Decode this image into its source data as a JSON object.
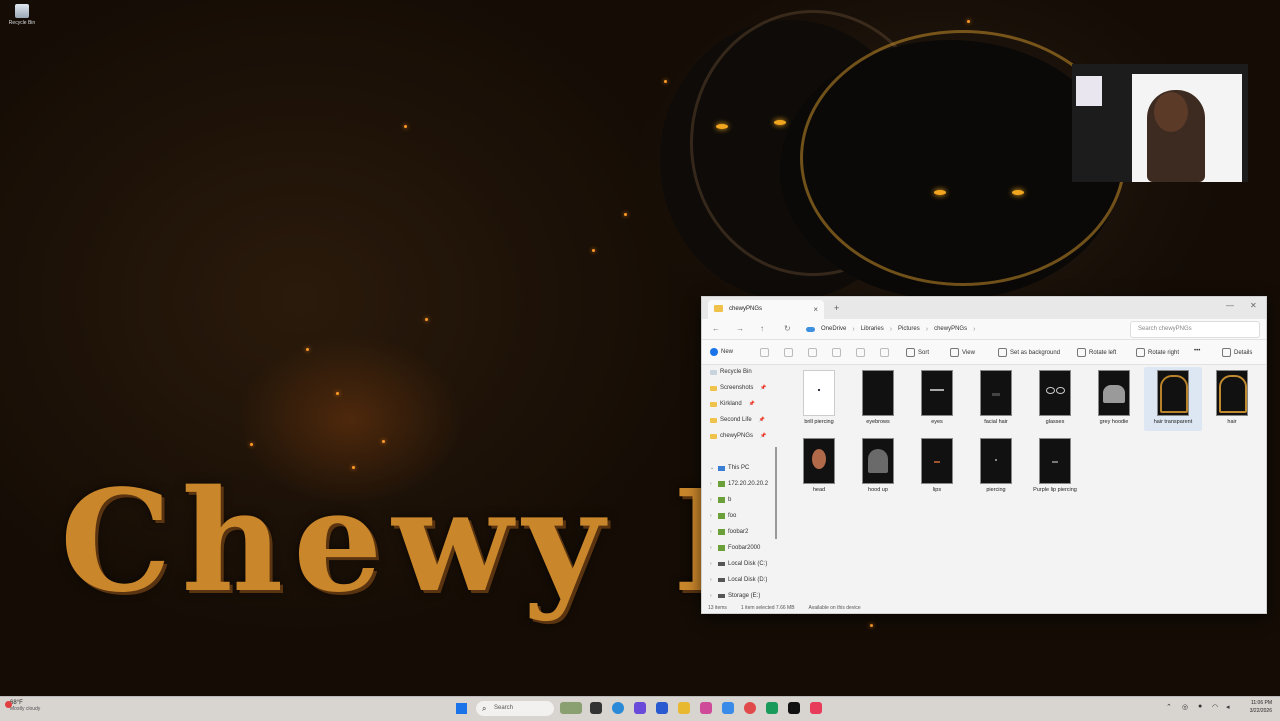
{
  "desktop": {
    "recycle_bin_label": "Recycle Bin",
    "brand_text": "Chewy K"
  },
  "explorer": {
    "tab_title": "chewyPNGs",
    "breadcrumbs": [
      "OneDrive",
      "Libraries",
      "Pictures",
      "chewyPNGs"
    ],
    "search_placeholder": "Search chewyPNGs",
    "toolbar": {
      "new": "New",
      "sort": "Sort",
      "view": "View",
      "set_background": "Set as background",
      "rotate_left": "Rotate left",
      "rotate_right": "Rotate right",
      "more": "•••",
      "details": "Details"
    },
    "quick_access": [
      "Recycle Bin",
      "Screenshots",
      "Kirkland",
      "Second Life",
      "chewyPNGs"
    ],
    "this_pc": "This PC",
    "drives": [
      "172.20.20.20.2",
      "b",
      "foo",
      "foobar2",
      "Foobar2000",
      "Local Disk (C:)",
      "Local Disk (D:)",
      "Storage (E:)"
    ],
    "files": [
      {
        "name": "brill piercing"
      },
      {
        "name": "eyebrows"
      },
      {
        "name": "eyes"
      },
      {
        "name": "facial hair"
      },
      {
        "name": "glasses"
      },
      {
        "name": "grey hoodie"
      },
      {
        "name": "hair transparent"
      },
      {
        "name": "hair"
      },
      {
        "name": "head"
      },
      {
        "name": "hood up"
      },
      {
        "name": "lips"
      },
      {
        "name": "piercing"
      },
      {
        "name": "Purple lip piercing"
      }
    ],
    "status": {
      "items": "13 items",
      "selected": "1 item selected  7.66 MB",
      "availability": "Available on this device"
    }
  },
  "taskbar": {
    "weather_temp": "68°F",
    "weather_cond": "Mostly cloudy",
    "search_label": "Search",
    "time": "11:06 PM",
    "date": "3/22/2026"
  }
}
